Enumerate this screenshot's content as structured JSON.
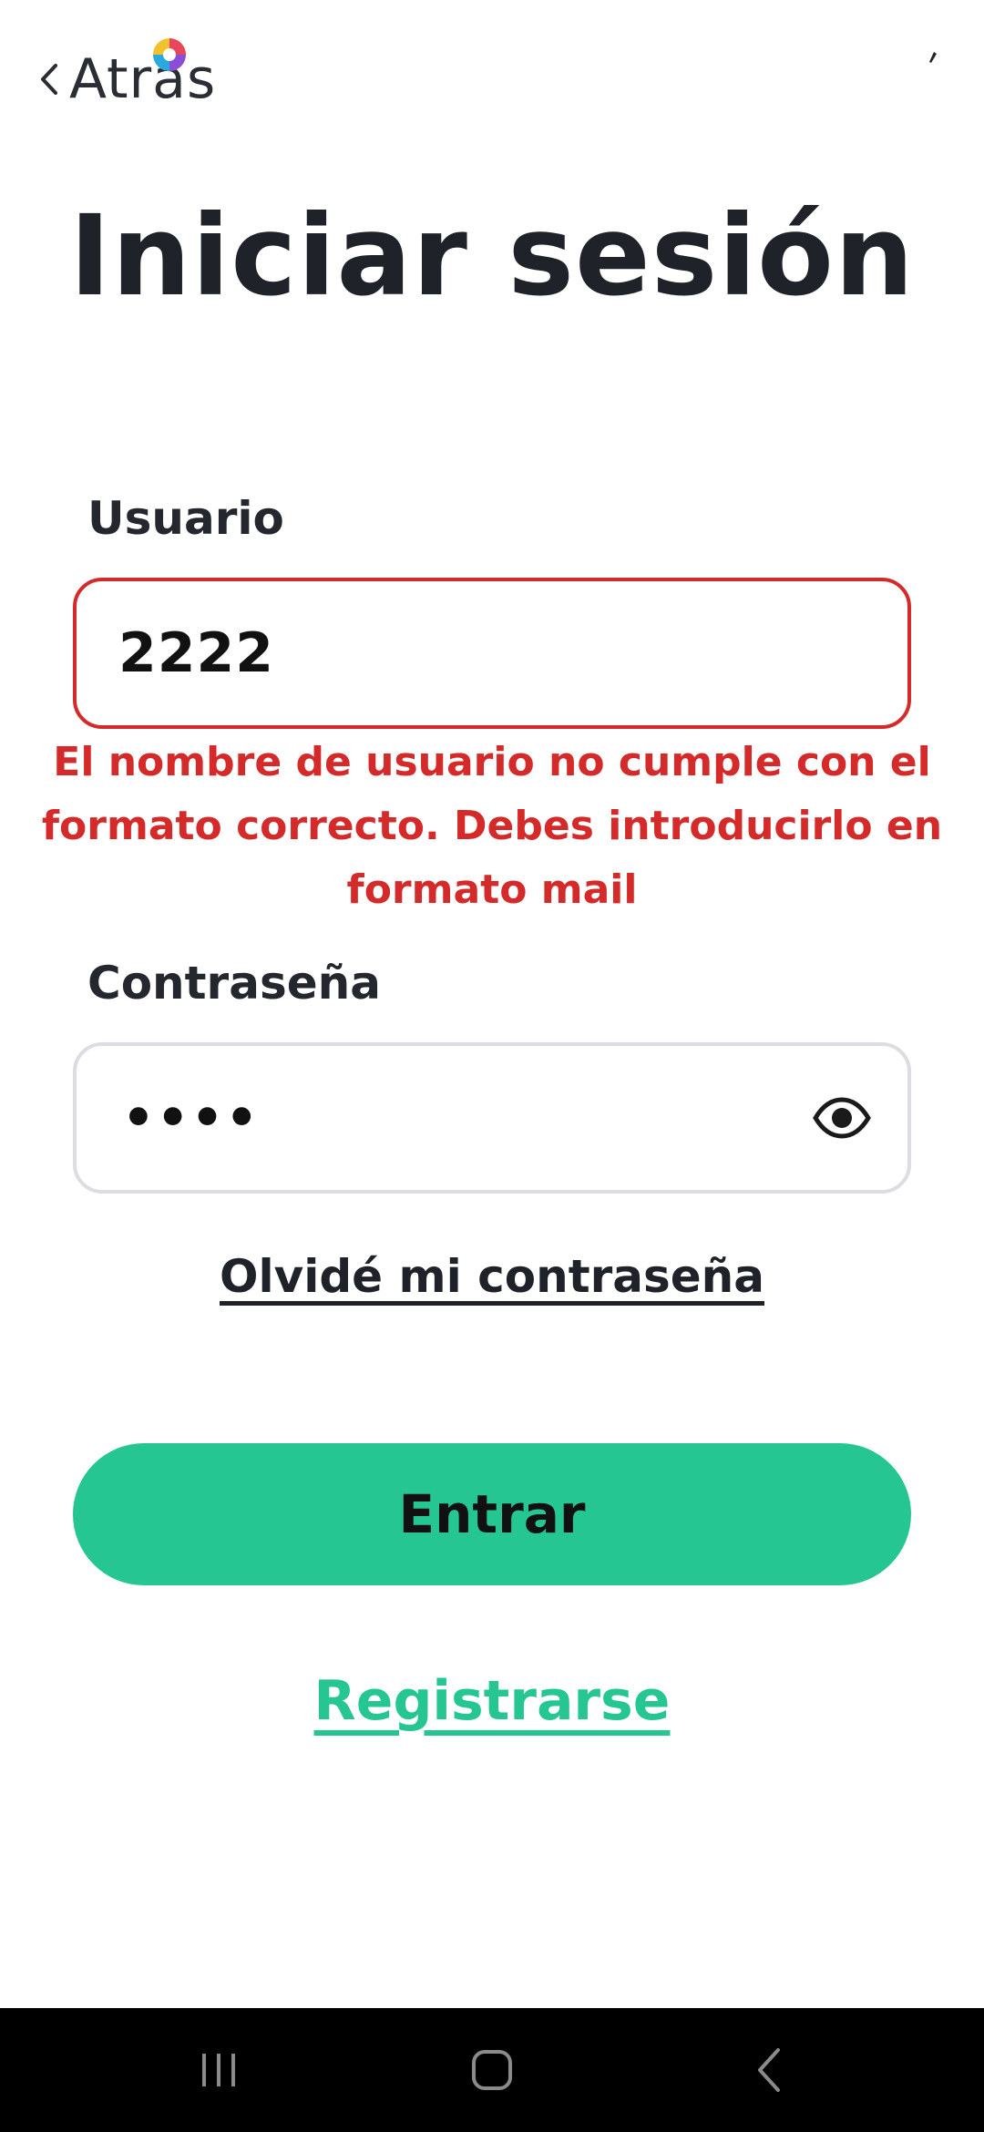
{
  "header": {
    "back_label": "Atrás"
  },
  "title": "Iniciar sesión",
  "form": {
    "username": {
      "label": "Usuario",
      "value": "2222",
      "error": "El nombre de usuario no cumple con el formato correcto. Debes introducirlo en formato mail"
    },
    "password": {
      "label": "Contraseña",
      "masked_value": "••••"
    },
    "forgot_label": "Olvidé mi contraseña",
    "submit_label": "Entrar",
    "register_label": "Registrarse"
  },
  "colors": {
    "primary": "#25c692",
    "error": "#d52a2a",
    "text": "#1f2228",
    "input_border": "#dcdde2",
    "nav_bar": "#000000"
  },
  "icons": {
    "back": "chevron-left-icon",
    "password_toggle": "eye-icon",
    "nav_recents": "recents-icon",
    "nav_home": "home-icon",
    "nav_back": "nav-back-icon"
  }
}
